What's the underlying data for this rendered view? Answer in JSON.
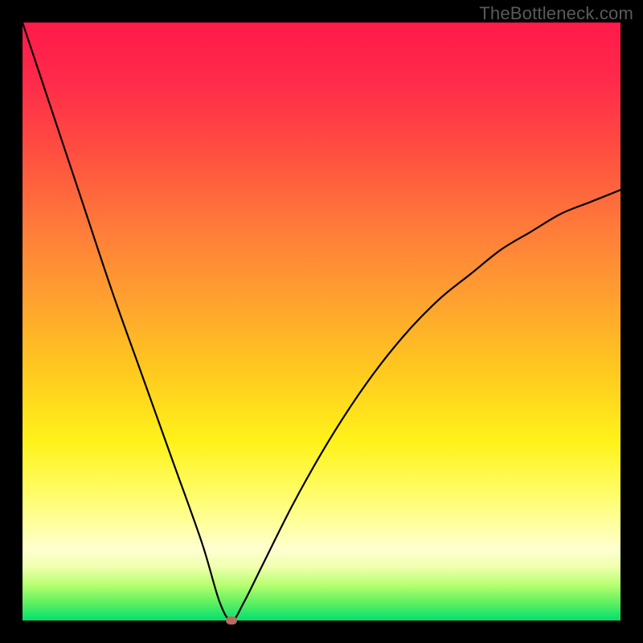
{
  "watermark": "TheBottleneck.com",
  "chart_data": {
    "type": "line",
    "title": "",
    "xlabel": "",
    "ylabel": "",
    "xlim": [
      0,
      100
    ],
    "ylim": [
      0,
      100
    ],
    "grid": false,
    "legend": false,
    "series": [
      {
        "name": "bottleneck-curve",
        "x": [
          0,
          5,
          10,
          15,
          20,
          25,
          30,
          33,
          35,
          37,
          40,
          45,
          50,
          55,
          60,
          65,
          70,
          75,
          80,
          85,
          90,
          95,
          100
        ],
        "values": [
          100,
          85,
          70,
          55,
          41,
          27,
          13,
          3,
          0,
          3,
          9,
          19,
          28,
          36,
          43,
          49,
          54,
          58,
          62,
          65,
          68,
          70,
          72
        ]
      }
    ],
    "annotations": [
      {
        "name": "optimal-marker",
        "x": 35,
        "y": 0
      }
    ],
    "background_gradient": {
      "top": "#ff1a4a",
      "mid": "#ffd400",
      "bottom": "#00e070"
    }
  }
}
